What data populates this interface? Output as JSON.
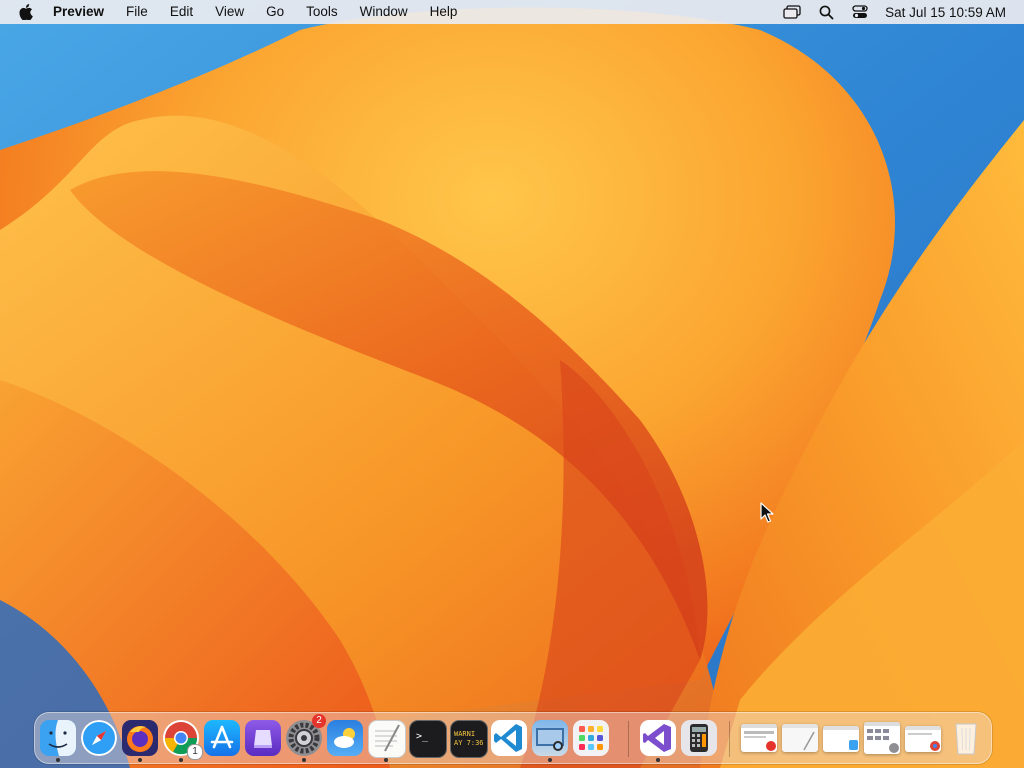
{
  "menubar": {
    "app_name": "Preview",
    "menus": [
      "File",
      "Edit",
      "View",
      "Go",
      "Tools",
      "Window",
      "Help"
    ],
    "clock": "Sat Jul 15  10:59 AM"
  },
  "dock": {
    "apps": [
      {
        "name": "Finder",
        "icon": "finder-icon",
        "running": true
      },
      {
        "name": "Safari",
        "icon": "safari-icon",
        "running": false
      },
      {
        "name": "Firefox",
        "icon": "firefox-icon",
        "running": true
      },
      {
        "name": "Google Chrome",
        "icon": "chrome-icon",
        "running": true,
        "badge": "1"
      },
      {
        "name": "App Store",
        "icon": "app-store-icon",
        "running": false
      },
      {
        "name": "Apple Configurator",
        "icon": "configurator-icon",
        "running": false
      },
      {
        "name": "System Settings",
        "icon": "system-settings-icon",
        "running": true,
        "badge": "2"
      },
      {
        "name": "Weather",
        "icon": "weather-icon",
        "running": false
      },
      {
        "name": "TextEdit",
        "icon": "textedit-icon",
        "running": true
      },
      {
        "name": "Terminal",
        "icon": "terminal-icon",
        "running": false
      },
      {
        "name": "Console",
        "icon": "console-icon",
        "running": false,
        "text": "WARNI\nAY 7:36"
      },
      {
        "name": "Visual Studio Code",
        "icon": "vscode-icon",
        "running": false
      },
      {
        "name": "Preview",
        "icon": "preview-icon",
        "running": true
      },
      {
        "name": "Launchpad",
        "icon": "launchpad-icon",
        "running": false
      },
      {
        "name": "Visual Studio",
        "icon": "visual-studio-icon",
        "running": true
      },
      {
        "name": "Calculator",
        "icon": "calculator-icon",
        "running": false
      }
    ],
    "minimized": [
      {
        "icon": "minimized-window-1"
      },
      {
        "icon": "minimized-window-2"
      },
      {
        "icon": "minimized-window-3"
      },
      {
        "icon": "minimized-window-4"
      },
      {
        "icon": "minimized-window-5"
      }
    ],
    "trash": {
      "icon": "trash-icon"
    }
  },
  "colors": {
    "sky": "#3f8fd8",
    "petal_light": "#fbb83a",
    "petal_dark": "#e85a1a",
    "accent_badge": "#e5342b"
  }
}
